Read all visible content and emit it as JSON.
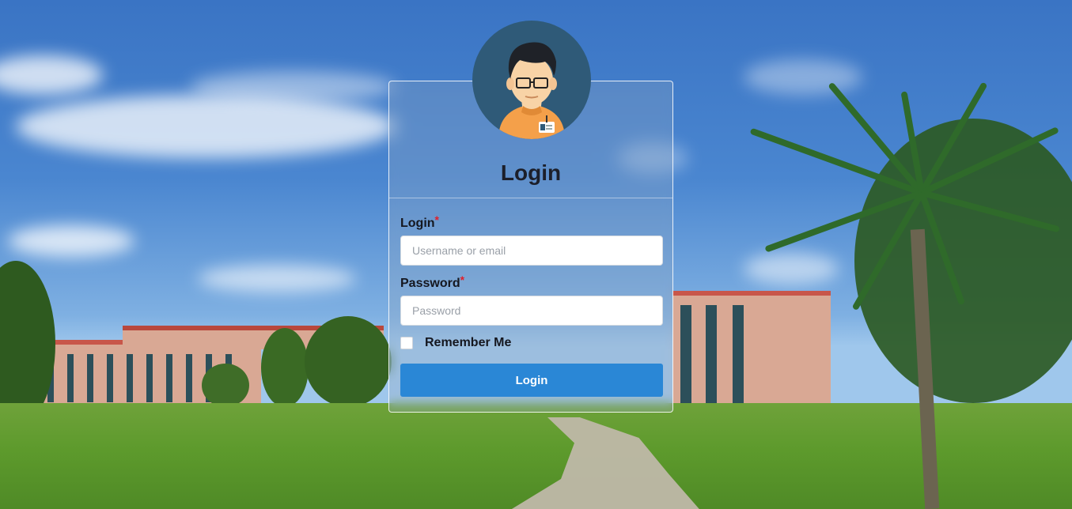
{
  "login_form": {
    "title": "Login",
    "username_label": "Login",
    "username_placeholder": "Username or email",
    "password_label": "Password",
    "password_placeholder": "Password",
    "required_marker": "*",
    "remember_label": "Remember Me",
    "remember_checked": false,
    "submit_label": "Login"
  },
  "icons": {
    "avatar": "user-avatar-icon"
  },
  "colors": {
    "submit_button": "#2a87d6",
    "required_marker": "#e0202a",
    "avatar_background": "#2f5a78"
  }
}
